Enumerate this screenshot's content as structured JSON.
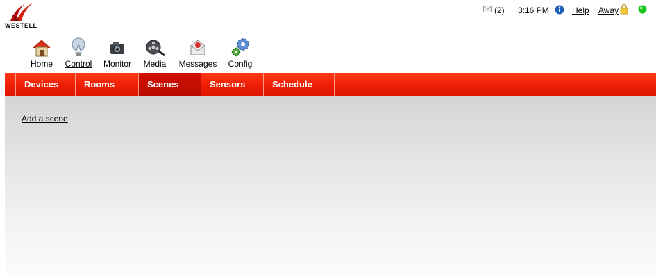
{
  "brand": {
    "logo_text": "WESTELL"
  },
  "status": {
    "message_count": "(2)",
    "time": "3:16 PM",
    "help_label": "Help",
    "mode_label": "Away",
    "icons": [
      "mail-icon",
      "info-icon",
      "lock-icon",
      "online-status-icon"
    ],
    "online_color": "#19c419"
  },
  "toolbar": {
    "items": [
      {
        "label": "Home",
        "icon": "home-icon"
      },
      {
        "label": "Control",
        "icon": "lightbulb-icon",
        "active": true
      },
      {
        "label": "Monitor",
        "icon": "camera-icon"
      },
      {
        "label": "Media",
        "icon": "film-reel-icon"
      },
      {
        "label": "Messages",
        "icon": "envelope-icon"
      },
      {
        "label": "Config",
        "icon": "gears-icon"
      }
    ]
  },
  "nav": {
    "tabs": [
      {
        "label": "Devices"
      },
      {
        "label": "Rooms"
      },
      {
        "label": "Scenes",
        "selected": true
      },
      {
        "label": "Sensors"
      },
      {
        "label": "Schedule"
      }
    ],
    "bar_color": "#ee1d04"
  },
  "main": {
    "add_scene_link": "Add a scene"
  }
}
